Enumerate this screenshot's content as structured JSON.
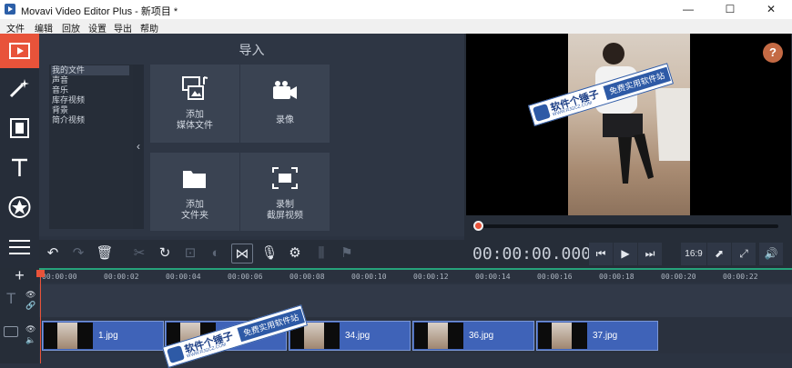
{
  "window": {
    "title": "Movavi Video Editor Plus - 新项目 *",
    "minimize": "—",
    "maximize": "☐",
    "close": "✕"
  },
  "menu": [
    "文件",
    "编辑",
    "回放",
    "设置",
    "导出",
    "帮助"
  ],
  "sidebar": {
    "tools": [
      "import-icon",
      "magic-wand-icon",
      "filmstrip-icon",
      "text-icon",
      "star-icon",
      "menu-icon"
    ],
    "active": "import-icon"
  },
  "import": {
    "title": "导入",
    "categories": [
      "我的文件",
      "声音",
      "音乐",
      "库存视频",
      "背景",
      "简介视频"
    ],
    "selected_category": "我的文件",
    "collapse": "‹",
    "tiles": [
      {
        "label1": "添加",
        "label2": "媒体文件",
        "icon": "media-files-icon"
      },
      {
        "label1": "录像",
        "label2": "",
        "icon": "camera-icon"
      },
      {
        "label1": "添加",
        "label2": "文件夹",
        "icon": "folder-icon"
      },
      {
        "label1": "录制",
        "label2": "截屏视频",
        "icon": "screen-capture-icon"
      }
    ]
  },
  "player": {
    "help": "?",
    "timecode": "00:00:00.000",
    "progress": 0,
    "aspect": "16:9"
  },
  "watermark": {
    "main": "软件个锤子",
    "sub": "WWW.RJGCZ.COM",
    "band": "免费实用软件站"
  },
  "timeline": {
    "ticks": [
      "00:00:00",
      "00:00:02",
      "00:00:04",
      "00:00:06",
      "00:00:08",
      "00:00:10",
      "00:00:12",
      "00:00:14",
      "00:00:16",
      "00:00:18",
      "00:00:20",
      "00:00:22"
    ],
    "add": "+",
    "clips": [
      "1.jpg",
      "",
      "",
      "34.jpg",
      "36.jpg",
      "37.jpg"
    ]
  },
  "colors": {
    "accent": "#e8533a",
    "clip": "#3f63b8",
    "ruler_line": "#26a37a",
    "watermark": "#2e5aa6"
  }
}
